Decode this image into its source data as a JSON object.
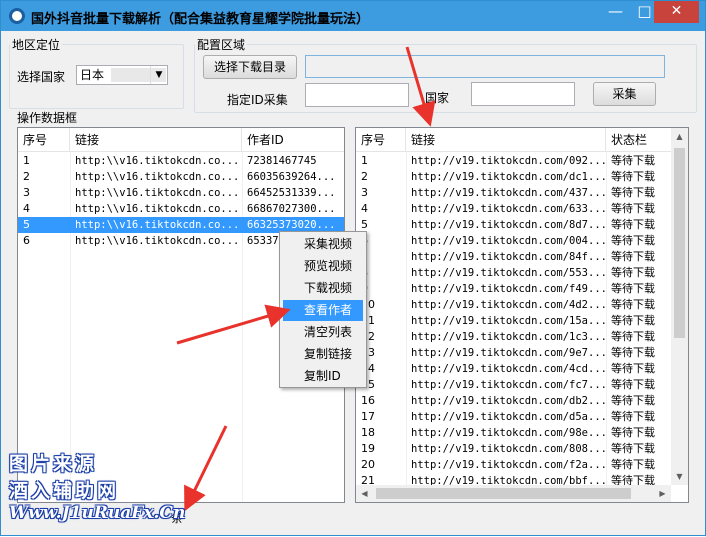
{
  "window": {
    "title": "国外抖音批量下载解析（配合集益教育星耀学院批量玩法）",
    "min": "—",
    "max": "□",
    "close": "✕"
  },
  "region": {
    "legend": "地区定位",
    "country_label": "选择国家",
    "country_value": "日本"
  },
  "config": {
    "legend": "配置区域",
    "choose_dir_button": "选择下载目录",
    "path_value": "",
    "id_label": "指定ID采集",
    "id_value": "",
    "country_label": "国家",
    "country_value": "",
    "collect_button": "采集"
  },
  "ops": {
    "legend": "操作数据框"
  },
  "left_list": {
    "columns": [
      "序号",
      "链接",
      "作者ID"
    ],
    "rows": [
      [
        "1",
        "http:\\\\v16.tiktokcdn.co...",
        "72381467745"
      ],
      [
        "2",
        "http:\\\\v16.tiktokcdn.co...",
        "66035639264..."
      ],
      [
        "3",
        "http:\\\\v16.tiktokcdn.co...",
        "66452531339..."
      ],
      [
        "4",
        "http:\\\\v16.tiktokcdn.co...",
        "66867027300..."
      ],
      [
        "5",
        "http:\\\\v16.tiktokcdn.co...",
        "66325373020..."
      ],
      [
        "6",
        "http:\\\\v16.tiktokcdn.co...",
        "653373..."
      ]
    ],
    "selected_index": 4
  },
  "context_menu": {
    "items": [
      "采集视频",
      "预览视频",
      "下载视频",
      "查看作者",
      "清空列表",
      "复制链接",
      "复制ID"
    ],
    "highlighted_index": 3
  },
  "right_list": {
    "columns": [
      "序号",
      "链接",
      "状态栏"
    ],
    "rows": [
      [
        "1",
        "http://v19.tiktokcdn.com/092...",
        "等待下载"
      ],
      [
        "2",
        "http://v19.tiktokcdn.com/dc1...",
        "等待下载"
      ],
      [
        "3",
        "http://v19.tiktokcdn.com/437...",
        "等待下载"
      ],
      [
        "4",
        "http://v19.tiktokcdn.com/633...",
        "等待下载"
      ],
      [
        "5",
        "http://v19.tiktokcdn.com/8d7...",
        "等待下载"
      ],
      [
        "6",
        "http://v19.tiktokcdn.com/004...",
        "等待下载"
      ],
      [
        "7",
        "http://v19.tiktokcdn.com/84f...",
        "等待下载"
      ],
      [
        "8",
        "http://v19.tiktokcdn.com/553...",
        "等待下载"
      ],
      [
        "9",
        "http://v19.tiktokcdn.com/f49...",
        "等待下载"
      ],
      [
        "10",
        "http://v19.tiktokcdn.com/4d2...",
        "等待下载"
      ],
      [
        "11",
        "http://v19.tiktokcdn.com/15a...",
        "等待下载"
      ],
      [
        "12",
        "http://v19.tiktokcdn.com/1c3...",
        "等待下载"
      ],
      [
        "13",
        "http://v19.tiktokcdn.com/9e7...",
        "等待下载"
      ],
      [
        "14",
        "http://v19.tiktokcdn.com/4cd...",
        "等待下载"
      ],
      [
        "15",
        "http://v19.tiktokcdn.com/fc7...",
        "等待下载"
      ],
      [
        "16",
        "http://v19.tiktokcdn.com/db2...",
        "等待下载"
      ],
      [
        "17",
        "http://v19.tiktokcdn.com/d5a...",
        "等待下载"
      ],
      [
        "18",
        "http://v19.tiktokcdn.com/98e...",
        "等待下载"
      ],
      [
        "19",
        "http://v19.tiktokcdn.com/808...",
        "等待下载"
      ],
      [
        "20",
        "http://v19.tiktokcdn.com/f2a...",
        "等待下载"
      ],
      [
        "21",
        "http://v19.tiktokcdn.com/bbf...",
        "等待下载"
      ]
    ]
  },
  "status": {
    "text": "条"
  },
  "watermark": {
    "line1": "图片来源",
    "line2": "酒入辅助网",
    "line3": "Www.J1uRuaFx.Cn"
  },
  "colors": {
    "titlebar": "#3d9be0",
    "selection": "#3399ff",
    "arrow": "#e8322b"
  }
}
